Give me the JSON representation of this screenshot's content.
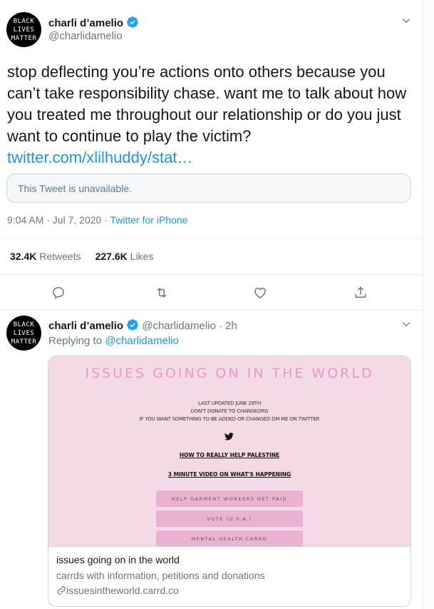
{
  "tweet": {
    "avatar_lines": [
      "BLACK",
      "LIVES",
      "MATTER"
    ],
    "name": "charli d’amelio",
    "handle": "@charlidamelio",
    "text": "stop deflecting you’re actions onto others because you can’t take responsibility chase. want me to talk about how you treated me throughout our relationship or do you just want to continue to play the victim?",
    "link": "twitter.com/xlilhuddy/stat…",
    "quoted_unavailable": "This Tweet is unavailable.",
    "timestamp": "9:04 AM · Jul 7, 2020",
    "separator": " · ",
    "source": "Twitter for iPhone",
    "retweets_count": "32.4K",
    "retweets_label": "Retweets",
    "likes_count": "227.6K",
    "likes_label": "Likes"
  },
  "actions": [
    "reply-icon",
    "retweet-icon",
    "like-icon",
    "share-icon"
  ],
  "reply": {
    "avatar_lines": [
      "BLACK",
      "LIVES",
      "MATTER"
    ],
    "name": "charli d’amelio",
    "handle": "@charlidamelio",
    "time": "· 2h",
    "replying_prefix": "Replying to",
    "replying_to": "@charlidamelio",
    "card": {
      "image_title": "ISSUES GOING ON IN THE WORLD",
      "lines": [
        "LAST UPDATED JUNE 29TH",
        "DON'T DONATE TO CHANGEORG",
        "IF YOU WANT SOMETHING TO BE ADDED OR CHANGED DM ME ON TWITTER"
      ],
      "link1": "HOW TO REALLY HELP PALESTINE",
      "link2": "3 MINUTE VIDEO ON WHAT'S HAPPENING",
      "buttons": [
        "HELP GARMENT WORKERS GET PAID",
        "VOTE (U.S.A.)",
        "MENTAL HEALTH CARRD"
      ],
      "title": "issues going on in the world",
      "description": "carrds with information, petitions and donations",
      "url": "issuesintheworld.carrd.co"
    }
  },
  "colors": {
    "accent": "#1b95e0",
    "card_bg": "#f4d9e7",
    "card_title": "#e59ac6",
    "card_button": "#e9b2d2"
  }
}
